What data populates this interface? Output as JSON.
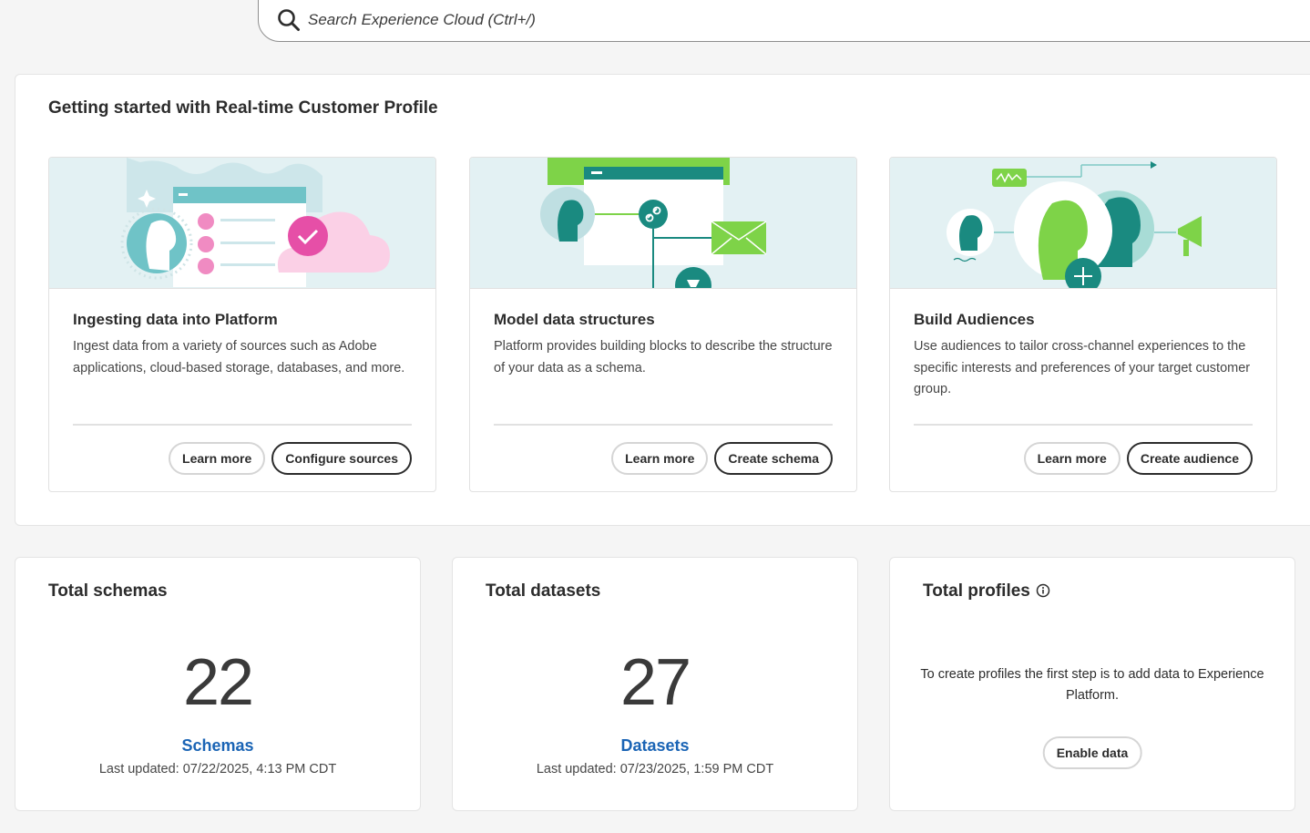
{
  "search": {
    "placeholder": "Search Experience Cloud (Ctrl+/)",
    "icon": "search-icon"
  },
  "getting_started": {
    "title": "Getting started with Real-time Customer Profile",
    "cards": [
      {
        "title": "Ingesting data into Platform",
        "description": "Ingest data from a variety of sources such as Adobe applications, cloud-based storage, databases, and more.",
        "secondary_label": "Learn more",
        "primary_label": "Configure sources"
      },
      {
        "title": "Model data structures",
        "description": "Platform provides building blocks to describe the structure of your data as a schema.",
        "secondary_label": "Learn more",
        "primary_label": "Create schema"
      },
      {
        "title": "Build Audiences",
        "description": "Use audiences to tailor cross-channel experiences to the specific interests and preferences of your target customer group.",
        "secondary_label": "Learn more",
        "primary_label": "Create audience"
      }
    ]
  },
  "stats": {
    "schemas": {
      "title": "Total schemas",
      "value": "22",
      "link": "Schemas",
      "updated": "Last updated: 07/22/2025, 4:13 PM CDT"
    },
    "datasets": {
      "title": "Total datasets",
      "value": "27",
      "link": "Datasets",
      "updated": "Last updated: 07/23/2025, 1:59 PM CDT"
    },
    "profiles": {
      "title": "Total profiles",
      "info_icon": "info-icon",
      "message": "To create profiles the first step is to add data to Experience Platform.",
      "button": "Enable data"
    }
  },
  "colors": {
    "link_blue": "#1a64b5",
    "teal": "#1a8a80",
    "lime": "#7ed348",
    "pink": "#e64fa7",
    "illustration_bg": "#e3f1f3"
  }
}
